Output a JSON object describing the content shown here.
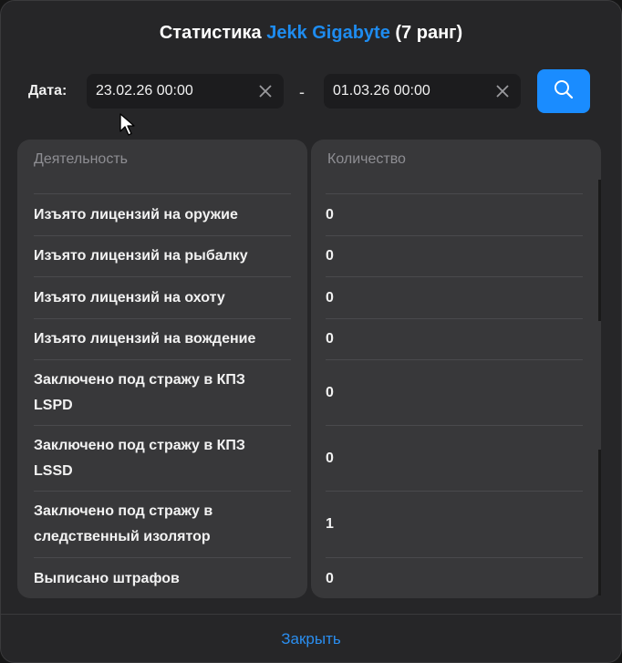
{
  "header": {
    "title_prefix": "Статистика",
    "player_name": "Jekk Gigabyte",
    "rank": "(7 ранг)"
  },
  "filter": {
    "date_label": "Дата:",
    "date_from": "23.02.26 00:00",
    "date_to": "01.03.26 00:00",
    "separator": "-"
  },
  "table": {
    "columns": [
      "Деятельность",
      "Количество"
    ],
    "rows": [
      {
        "activity": "Изъято лицензий на оружие",
        "count": "0"
      },
      {
        "activity": "Изъято лицензий на рыбалку",
        "count": "0"
      },
      {
        "activity": "Изъято лицензий на охоту",
        "count": "0"
      },
      {
        "activity": "Изъято лицензий на вождение",
        "count": "0"
      },
      {
        "activity": "Заключено под стражу в КПЗ LSPD",
        "count": "0"
      },
      {
        "activity": "Заключено под стражу в КПЗ LSSD",
        "count": "0"
      },
      {
        "activity": "Заключено под стражу в следственный изолятор",
        "count": "1"
      },
      {
        "activity": "Выписано штрафов",
        "count": "0"
      }
    ]
  },
  "footer": {
    "close_label": "Закрыть"
  },
  "colors": {
    "accent": "#1a8cff",
    "name": "#1e8cf0",
    "panel": "#38383a"
  }
}
